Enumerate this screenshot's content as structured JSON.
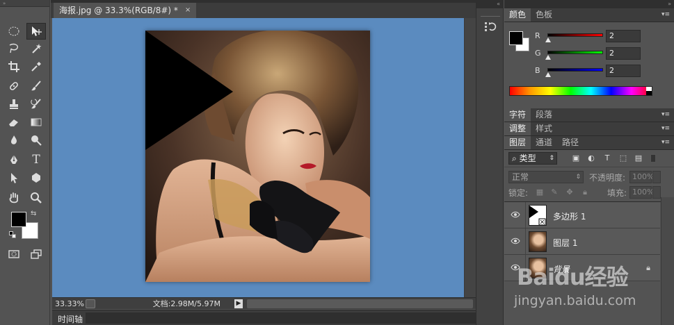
{
  "document": {
    "tab_title": "海报.jpg @ 33.3%(RGB/8#) *",
    "close_glyph": "×",
    "zoom": "33.33%",
    "doc_info": "文档:2.98M/5.97M"
  },
  "timeline": {
    "label": "时间轴"
  },
  "toolbox": {
    "fg_color": "#000000",
    "bg_color": "#ffffff",
    "tools": [
      {
        "name": "marquee-tool-icon"
      },
      {
        "name": "move-tool-icon"
      },
      {
        "name": "lasso-tool-icon"
      },
      {
        "name": "magic-wand-tool-icon"
      },
      {
        "name": "crop-tool-icon"
      },
      {
        "name": "eyedropper-tool-icon"
      },
      {
        "name": "healing-brush-tool-icon"
      },
      {
        "name": "brush-tool-icon"
      },
      {
        "name": "clone-stamp-tool-icon"
      },
      {
        "name": "history-brush-tool-icon"
      },
      {
        "name": "eraser-tool-icon"
      },
      {
        "name": "gradient-tool-icon"
      },
      {
        "name": "blur-tool-icon"
      },
      {
        "name": "dodge-tool-icon"
      },
      {
        "name": "pen-tool-icon"
      },
      {
        "name": "type-tool-icon"
      },
      {
        "name": "path-selection-tool-icon"
      },
      {
        "name": "polygon-tool-icon"
      },
      {
        "name": "hand-tool-icon"
      },
      {
        "name": "zoom-tool-icon"
      }
    ],
    "type_glyph": "T"
  },
  "color_panel": {
    "tabs": [
      "颜色",
      "色板"
    ],
    "sliders": [
      {
        "label": "R",
        "value": "2",
        "gradient": [
          "#000000",
          "#ff0000"
        ]
      },
      {
        "label": "G",
        "value": "2",
        "gradient": [
          "#000000",
          "#00ff00"
        ]
      },
      {
        "label": "B",
        "value": "2",
        "gradient": [
          "#000000",
          "#0000ff"
        ]
      }
    ]
  },
  "char_panel": {
    "tabs": [
      "字符",
      "段落"
    ]
  },
  "adjust_panel": {
    "tabs": [
      "调整",
      "样式"
    ]
  },
  "layers_panel": {
    "tabs": [
      "图层",
      "通道",
      "路径"
    ],
    "kind_filter": "类型",
    "blend_mode": "正常",
    "opacity_label": "不透明度:",
    "opacity_value": "100%",
    "lock_label": "锁定:",
    "fill_label": "填充:",
    "fill_value": "100%",
    "layers": [
      {
        "name": "多边形 1"
      },
      {
        "name": "图层 1"
      },
      {
        "name": "背景"
      }
    ]
  },
  "watermark": {
    "logo": "Baidu经验",
    "url": "jingyan.baidu.com"
  }
}
